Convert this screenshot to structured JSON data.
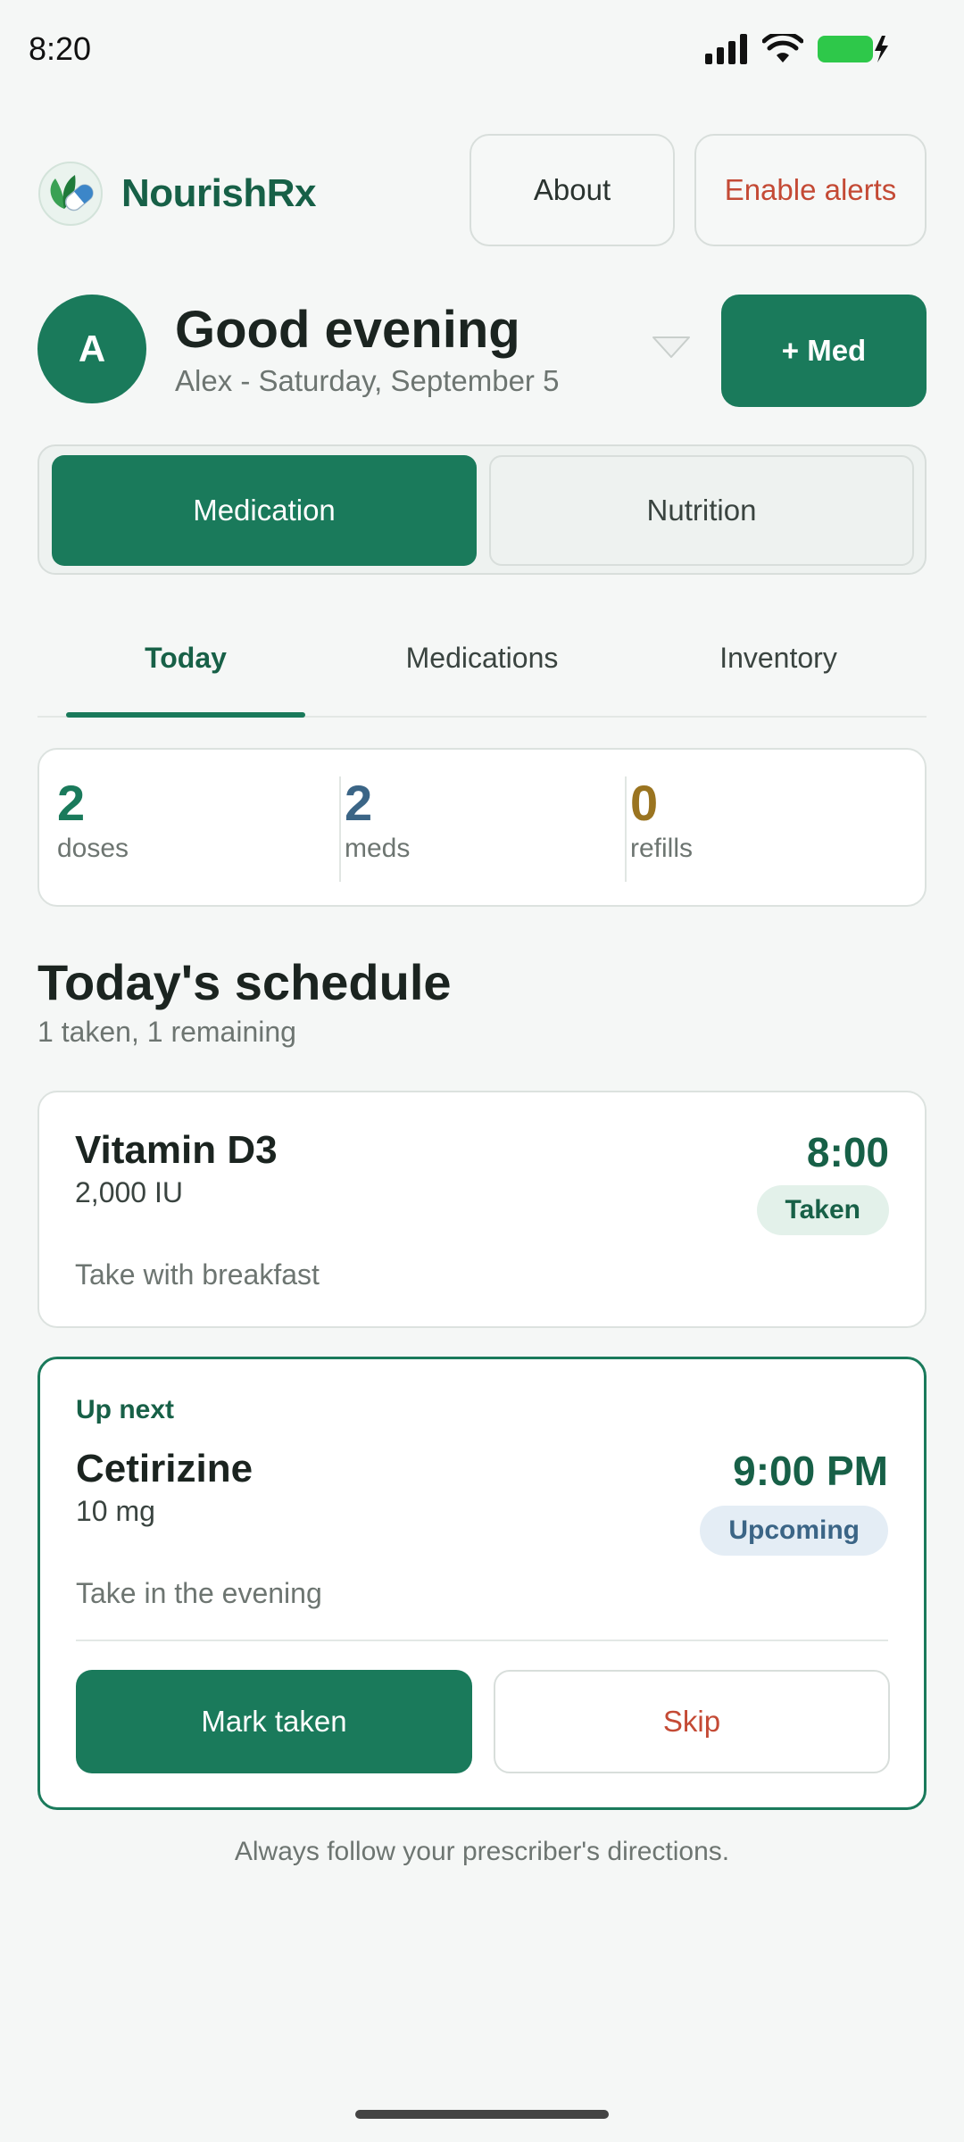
{
  "status_bar": {
    "time": "8:20"
  },
  "header": {
    "brand": "NourishRx",
    "about_label": "About",
    "alerts_label": "Enable alerts"
  },
  "greeting": {
    "avatar_initial": "A",
    "title": "Good evening",
    "subtitle": "Alex - Saturday, September 5",
    "add_med_label": "+ Med"
  },
  "segment": {
    "medication_label": "Medication",
    "nutrition_label": "Nutrition",
    "selected": "Medication"
  },
  "tabs": {
    "today": "Today",
    "medications": "Medications",
    "inventory": "Inventory",
    "active": "Today"
  },
  "stats": [
    {
      "value": "2",
      "label": "doses",
      "color": "#1a7a5b"
    },
    {
      "value": "2",
      "label": "meds",
      "color": "#3b6586"
    },
    {
      "value": "0",
      "label": "refills",
      "color": "#9a7420"
    }
  ],
  "schedule": {
    "title": "Today's schedule",
    "subtitle": "1 taken, 1 remaining",
    "items": [
      {
        "name": "Vitamin D3",
        "dose": "2,000 IU",
        "note": "Take with breakfast",
        "time": "8:00",
        "status": "Taken"
      },
      {
        "up_next_label": "Up next",
        "name": "Cetirizine",
        "dose": "10 mg",
        "note": "Take in the evening",
        "time": "9:00 PM",
        "status": "Upcoming",
        "mark_taken_label": "Mark taken",
        "skip_label": "Skip"
      }
    ]
  },
  "footer_note": "Always follow your prescriber's directions.",
  "colors": {
    "primary": "#1a7a5b",
    "primary_dark": "#176047",
    "danger": "#c44a35",
    "background": "#f5f7f6"
  }
}
